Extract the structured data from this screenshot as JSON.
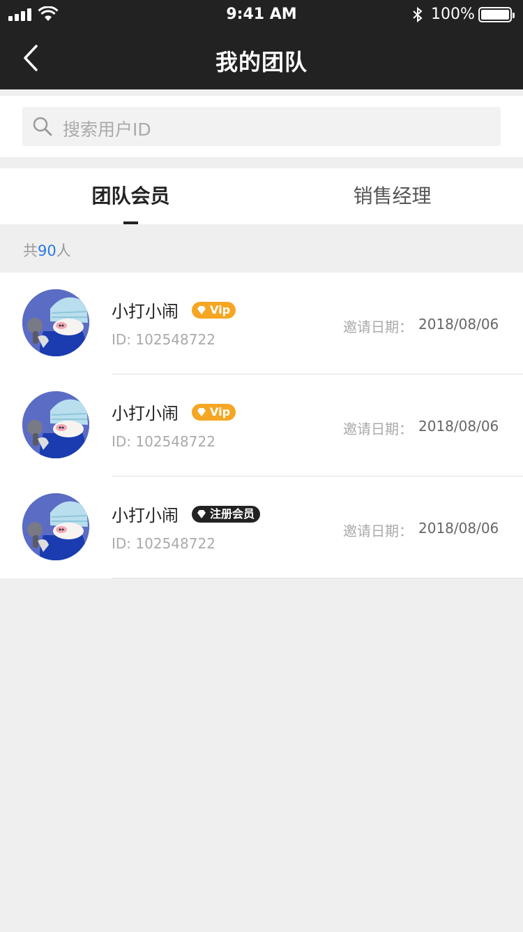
{
  "status_bar": {
    "time": "9:41 AM",
    "battery": "100%"
  },
  "nav": {
    "title": "我的团队",
    "back_icon": "chevron-left-icon"
  },
  "search": {
    "placeholder": "搜索用户ID",
    "icon": "search-icon"
  },
  "tabs": [
    {
      "label": "团队会员",
      "active": true
    },
    {
      "label": "销售经理",
      "active": false
    }
  ],
  "count": {
    "prefix": "共",
    "number": "90",
    "suffix": "人"
  },
  "members": [
    {
      "name": "小打小闹",
      "badge": "Vip",
      "badge_type": "vip",
      "id": "ID: 102548722",
      "invite_label": "邀请日期：",
      "invite_date": "2018/08/06"
    },
    {
      "name": "小打小闹",
      "badge": "Vip",
      "badge_type": "vip",
      "id": "ID: 102548722",
      "invite_label": "邀请日期：",
      "invite_date": "2018/08/06"
    },
    {
      "name": "小打小闹",
      "badge": "注册会员",
      "badge_type": "registered",
      "id": "ID: 102548722",
      "invite_label": "邀请日期：",
      "invite_date": "2018/08/06"
    }
  ],
  "colors": {
    "header_bg": "#222222",
    "accent_blue": "#2b77e6",
    "vip_orange": "#f5a623",
    "registered_black": "#222222"
  }
}
